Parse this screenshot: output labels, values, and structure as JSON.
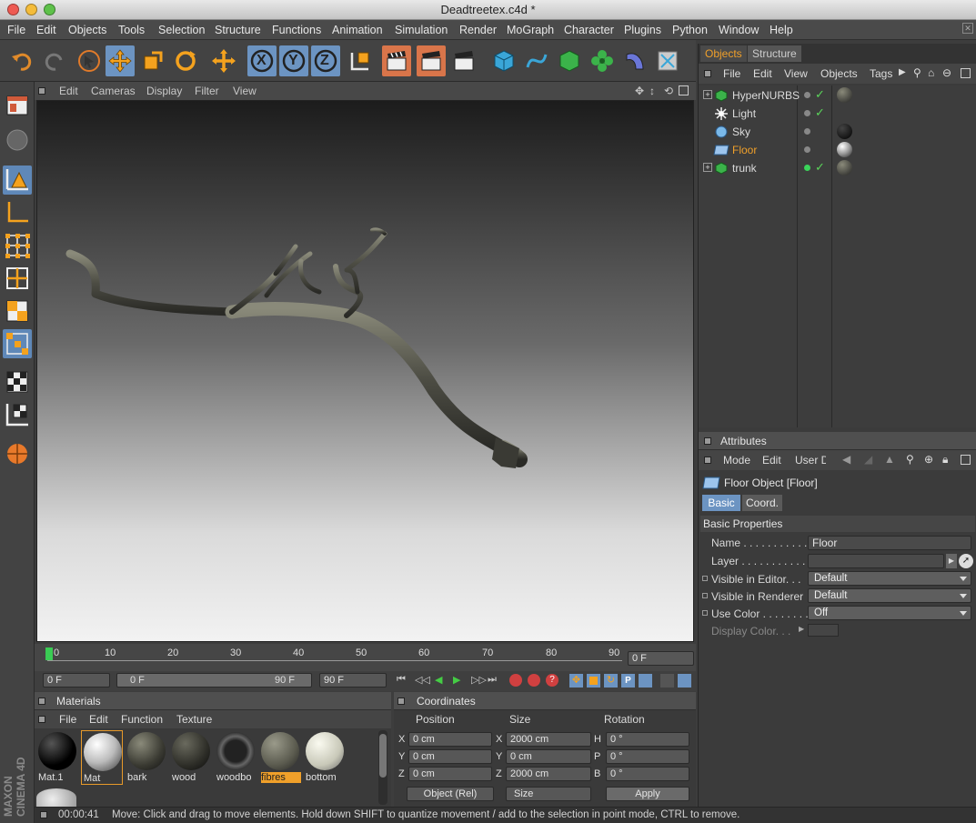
{
  "window": {
    "title": "Deadtreetex.c4d *"
  },
  "menubar": [
    "File",
    "Edit",
    "Objects",
    "Tools",
    "Selection",
    "Structure",
    "Functions",
    "Animation",
    "Simulation",
    "Render",
    "MoGraph",
    "Character",
    "Plugins",
    "Python",
    "Window",
    "Help"
  ],
  "toolbar": {
    "x_label": "X",
    "y_label": "Y",
    "z_label": "Z"
  },
  "viewport": {
    "menu": [
      "Edit",
      "Cameras",
      "Display",
      "Filter",
      "View"
    ]
  },
  "timeline": {
    "ticks": [
      "0",
      "10",
      "20",
      "30",
      "40",
      "50",
      "60",
      "70",
      "80",
      "90"
    ],
    "current_frame": "0 F",
    "start_frame": "0 F",
    "range_start": "0 F",
    "range_end": "90 F",
    "end_frame": "90 F"
  },
  "materials": {
    "title": "Materials",
    "menu": [
      "File",
      "Edit",
      "Function",
      "Texture"
    ],
    "items": [
      {
        "label": "Mat.1",
        "style": "black",
        "selected": false
      },
      {
        "label": "Mat",
        "style": "white",
        "selected": true
      },
      {
        "label": "bark",
        "style": "bark",
        "selected": false
      },
      {
        "label": "wood",
        "style": "wood",
        "selected": false
      },
      {
        "label": "woodbo",
        "style": "spiky",
        "selected": false
      },
      {
        "label": "fibres",
        "style": "fibres",
        "selected": false,
        "highlight": true
      },
      {
        "label": "bottom",
        "style": "bottom",
        "selected": false
      }
    ]
  },
  "coordinates": {
    "title": "Coordinates",
    "headers": [
      "Position",
      "Size",
      "Rotation"
    ],
    "rows": [
      {
        "axis": "X",
        "pos": "0 cm",
        "size_axis": "X",
        "size": "2000 cm",
        "rot_axis": "H",
        "rot": "0 °"
      },
      {
        "axis": "Y",
        "pos": "0 cm",
        "size_axis": "Y",
        "size": "0 cm",
        "rot_axis": "P",
        "rot": "0 °"
      },
      {
        "axis": "Z",
        "pos": "0 cm",
        "size_axis": "Z",
        "size": "2000 cm",
        "rot_axis": "B",
        "rot": "0 °"
      }
    ],
    "mode_select": "Object (Rel)",
    "size_select": "Size",
    "apply_label": "Apply"
  },
  "objects_panel": {
    "tabs": [
      "Objects",
      "Structure"
    ],
    "menu": [
      "File",
      "Edit",
      "View",
      "Objects",
      "Tags"
    ],
    "items": [
      {
        "name": "HyperNURBS",
        "expand": true,
        "active": false,
        "check": true,
        "tag": "bark"
      },
      {
        "name": "Light",
        "expand": false,
        "active": false,
        "check": true,
        "tag": ""
      },
      {
        "name": "Sky",
        "expand": false,
        "active": false,
        "check": false,
        "tag": "black"
      },
      {
        "name": "Floor",
        "expand": false,
        "active": true,
        "check": false,
        "tag": "white"
      },
      {
        "name": "trunk",
        "expand": true,
        "active": false,
        "check": true,
        "tag": "bark"
      }
    ]
  },
  "attributes": {
    "title": "Attributes",
    "menu": [
      "Mode",
      "Edit",
      "User Data"
    ],
    "object_title": "Floor Object [Floor]",
    "tabs": [
      "Basic",
      "Coord."
    ],
    "section": "Basic Properties",
    "name_label": "Name . . . . . . . . . . .",
    "name_value": "Floor",
    "layer_label": "Layer . . . . . . . . . . . .",
    "rows": [
      {
        "label": "Visible in Editor. . .",
        "value": "Default"
      },
      {
        "label": "Visible in Renderer",
        "value": "Default"
      },
      {
        "label": "Use Color . . . . . . . .",
        "value": "Off"
      }
    ],
    "display_color_label": "Display Color. . ."
  },
  "status": {
    "time": "00:00:41",
    "message": "Move: Click and drag to move elements. Hold down SHIFT to quantize movement / add to the selection in point mode, CTRL to remove."
  },
  "branding": {
    "logo_text": "MAXON CINEMA 4D"
  }
}
